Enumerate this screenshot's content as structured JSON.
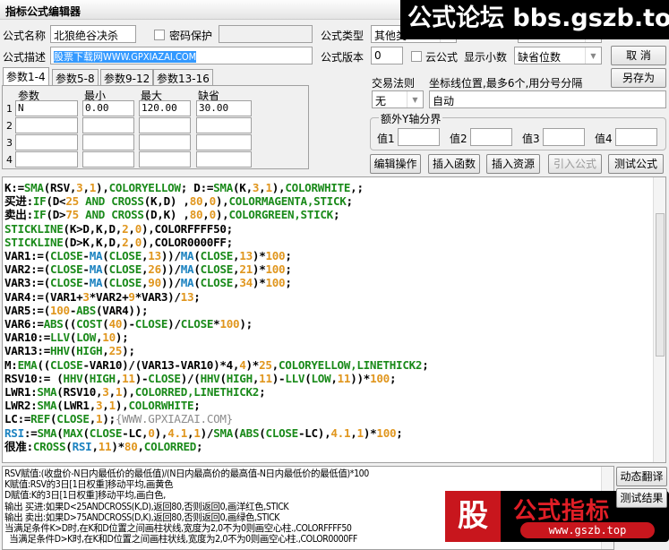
{
  "window": {
    "title": "指标公式编辑器"
  },
  "form": {
    "name_label": "公式名称",
    "name_value": "北狼绝谷决杀",
    "password_label": "密码保护",
    "password_value": "",
    "type_label": "公式类型",
    "type_value": "其他类",
    "desc_label": "公式描述",
    "desc_value": "股票下载网WWW.GPXIAZAI.COM",
    "version_label": "公式版本",
    "version_value": "0",
    "cloud_label": "云公式",
    "decimals_label": "显示小数",
    "decimals_value": "缺省位数",
    "trade_rule_label": "交易法则",
    "trade_rule_value": "无",
    "axis_label": "坐标线位置,最多6个,用分号分隔",
    "axis_value": "自动",
    "extra_y_label": "额外Y轴分界",
    "extra_values": [
      {
        "label": "值1",
        "value": ""
      },
      {
        "label": "值2",
        "value": ""
      },
      {
        "label": "值3",
        "value": ""
      },
      {
        "label": "值4",
        "value": ""
      }
    ]
  },
  "buttons": {
    "cancel": "取  消",
    "save_as": "另存为",
    "edit_ops": "编辑操作",
    "insert_func": "插入函数",
    "insert_res": "插入资源",
    "import_formula": "引入公式",
    "test_formula": "测试公式",
    "dynamic_translate": "动态翻译",
    "test_result": "测试结果"
  },
  "tabs": [
    "参数1-4",
    "参数5-8",
    "参数9-12",
    "参数13-16"
  ],
  "params": {
    "headers": [
      "参数",
      "最小",
      "最大",
      "缺省"
    ],
    "rows": [
      {
        "idx": "1",
        "name": "N",
        "min": "0.00",
        "max": "120.00",
        "def": "30.00"
      },
      {
        "idx": "2",
        "name": "",
        "min": "",
        "max": "",
        "def": ""
      },
      {
        "idx": "3",
        "name": "",
        "min": "",
        "max": "",
        "def": ""
      },
      {
        "idx": "4",
        "name": "",
        "min": "",
        "max": "",
        "def": ""
      }
    ]
  },
  "code": [
    [
      [
        "K:=",
        "t"
      ],
      [
        "SMA",
        "f"
      ],
      [
        "(RSV,",
        "t"
      ],
      [
        "3",
        "n"
      ],
      [
        ",",
        "t"
      ],
      [
        "1",
        "n"
      ],
      [
        "),",
        "t"
      ],
      [
        "COLORYELLOW",
        "f"
      ],
      [
        "; D:=",
        "t"
      ],
      [
        "SMA",
        "f"
      ],
      [
        "(K,",
        "t"
      ],
      [
        "3",
        "n"
      ],
      [
        ",",
        "t"
      ],
      [
        "1",
        "n"
      ],
      [
        "),",
        "t"
      ],
      [
        "COLORWHITE",
        "f"
      ],
      [
        ",;",
        "t"
      ]
    ],
    [
      [
        "买进:",
        "t"
      ],
      [
        "IF",
        "f"
      ],
      [
        "(D<",
        "t"
      ],
      [
        "25",
        "n"
      ],
      [
        " AND CROSS",
        "f"
      ],
      [
        "(K,D) ,",
        "t"
      ],
      [
        "80",
        "n"
      ],
      [
        ",",
        "t"
      ],
      [
        "0",
        "n"
      ],
      [
        "),",
        "t"
      ],
      [
        "COLORMAGENTA,STICK",
        "f"
      ],
      [
        ";",
        "t"
      ]
    ],
    [
      [
        "卖出:",
        "t"
      ],
      [
        "IF",
        "f"
      ],
      [
        "(D>",
        "t"
      ],
      [
        "75",
        "n"
      ],
      [
        " AND CROSS",
        "f"
      ],
      [
        "(D,K) ,",
        "t"
      ],
      [
        "80",
        "n"
      ],
      [
        ",",
        "t"
      ],
      [
        "0",
        "n"
      ],
      [
        "),",
        "t"
      ],
      [
        "COLORGREEN,STICK",
        "f"
      ],
      [
        ";",
        "t"
      ]
    ],
    [
      [
        "STICKLINE",
        "f"
      ],
      [
        "(K>D,K,D,",
        "t"
      ],
      [
        "2",
        "n"
      ],
      [
        ",",
        "t"
      ],
      [
        "0",
        "n"
      ],
      [
        "),COLORFFFF50;",
        "t"
      ]
    ],
    [
      [
        "STICKLINE",
        "f"
      ],
      [
        "(D>K,K,D,",
        "t"
      ],
      [
        "2",
        "n"
      ],
      [
        ",",
        "t"
      ],
      [
        "0",
        "n"
      ],
      [
        "),COLOR0000FF;",
        "t"
      ]
    ],
    [
      [
        "VAR1:=(",
        "t"
      ],
      [
        "CLOSE",
        "f"
      ],
      [
        "-",
        "t"
      ],
      [
        "MA",
        "b"
      ],
      [
        "(",
        "t"
      ],
      [
        "CLOSE",
        "f"
      ],
      [
        ",",
        "t"
      ],
      [
        "13",
        "n"
      ],
      [
        "))/",
        "t"
      ],
      [
        "MA",
        "b"
      ],
      [
        "(",
        "t"
      ],
      [
        "CLOSE",
        "f"
      ],
      [
        ",",
        "t"
      ],
      [
        "13",
        "n"
      ],
      [
        ")*",
        "t"
      ],
      [
        "100",
        "n"
      ],
      [
        ";",
        "t"
      ]
    ],
    [
      [
        "VAR2:=(",
        "t"
      ],
      [
        "CLOSE",
        "f"
      ],
      [
        "-",
        "t"
      ],
      [
        "MA",
        "b"
      ],
      [
        "(",
        "t"
      ],
      [
        "CLOSE",
        "f"
      ],
      [
        ",",
        "t"
      ],
      [
        "26",
        "n"
      ],
      [
        "))/",
        "t"
      ],
      [
        "MA",
        "b"
      ],
      [
        "(",
        "t"
      ],
      [
        "CLOSE",
        "f"
      ],
      [
        ",",
        "t"
      ],
      [
        "21",
        "n"
      ],
      [
        ")*",
        "t"
      ],
      [
        "100",
        "n"
      ],
      [
        ";",
        "t"
      ]
    ],
    [
      [
        "VAR3:=(",
        "t"
      ],
      [
        "CLOSE",
        "f"
      ],
      [
        "-",
        "t"
      ],
      [
        "MA",
        "b"
      ],
      [
        "(",
        "t"
      ],
      [
        "CLOSE",
        "f"
      ],
      [
        ",",
        "t"
      ],
      [
        "90",
        "n"
      ],
      [
        "))/",
        "t"
      ],
      [
        "MA",
        "b"
      ],
      [
        "(",
        "t"
      ],
      [
        "CLOSE",
        "f"
      ],
      [
        ",",
        "t"
      ],
      [
        "34",
        "n"
      ],
      [
        ")*",
        "t"
      ],
      [
        "100",
        "n"
      ],
      [
        ";",
        "t"
      ]
    ],
    [
      [
        "VAR4:=(VAR1+",
        "t"
      ],
      [
        "3",
        "n"
      ],
      [
        "*VAR2+",
        "t"
      ],
      [
        "9",
        "n"
      ],
      [
        "*VAR3)/",
        "t"
      ],
      [
        "13",
        "n"
      ],
      [
        ";",
        "t"
      ]
    ],
    [
      [
        "VAR5:=(",
        "t"
      ],
      [
        "100",
        "n"
      ],
      [
        "-",
        "t"
      ],
      [
        "ABS",
        "f"
      ],
      [
        "(VAR4));",
        "t"
      ]
    ],
    [
      [
        "VAR6:=",
        "t"
      ],
      [
        "ABS",
        "f"
      ],
      [
        "((",
        "t"
      ],
      [
        "COST",
        "f"
      ],
      [
        "(",
        "t"
      ],
      [
        "40",
        "n"
      ],
      [
        ")-",
        "t"
      ],
      [
        "CLOSE",
        "f"
      ],
      [
        ")/",
        "t"
      ],
      [
        "CLOSE",
        "f"
      ],
      [
        "*",
        "t"
      ],
      [
        "100",
        "n"
      ],
      [
        ");",
        "t"
      ]
    ],
    [
      [
        "VAR10:=",
        "t"
      ],
      [
        "LLV",
        "f"
      ],
      [
        "(",
        "t"
      ],
      [
        "LOW",
        "f"
      ],
      [
        ",",
        "t"
      ],
      [
        "10",
        "n"
      ],
      [
        ");",
        "t"
      ]
    ],
    [
      [
        "VAR13:=",
        "t"
      ],
      [
        "HHV",
        "f"
      ],
      [
        "(",
        "t"
      ],
      [
        "HIGH",
        "f"
      ],
      [
        ",",
        "t"
      ],
      [
        "25",
        "n"
      ],
      [
        ");",
        "t"
      ]
    ],
    [
      [
        "M:",
        "t"
      ],
      [
        "EMA",
        "f"
      ],
      [
        "((",
        "t"
      ],
      [
        "CLOSE",
        "f"
      ],
      [
        "-VAR10)/(VAR13-VAR10)*4,",
        "t"
      ],
      [
        "4",
        "n"
      ],
      [
        ")*",
        "t"
      ],
      [
        "25",
        "n"
      ],
      [
        ",",
        "t"
      ],
      [
        "COLORYELLOW,LINETHICK2",
        "f"
      ],
      [
        ";",
        "t"
      ]
    ],
    [
      [
        "RSV10:= (",
        "t"
      ],
      [
        "HHV",
        "f"
      ],
      [
        "(",
        "t"
      ],
      [
        "HIGH",
        "f"
      ],
      [
        ",",
        "t"
      ],
      [
        "11",
        "n"
      ],
      [
        ")-",
        "t"
      ],
      [
        "CLOSE",
        "f"
      ],
      [
        ")/(",
        "t"
      ],
      [
        "HHV",
        "f"
      ],
      [
        "(",
        "t"
      ],
      [
        "HIGH",
        "f"
      ],
      [
        ",",
        "t"
      ],
      [
        "11",
        "n"
      ],
      [
        ")-",
        "t"
      ],
      [
        "LLV",
        "f"
      ],
      [
        "(",
        "t"
      ],
      [
        "LOW",
        "f"
      ],
      [
        ",",
        "t"
      ],
      [
        "11",
        "n"
      ],
      [
        "))*",
        "t"
      ],
      [
        "100",
        "n"
      ],
      [
        ";",
        "t"
      ]
    ],
    [
      [
        "LWR1:",
        "t"
      ],
      [
        "SMA",
        "f"
      ],
      [
        "(RSV10,",
        "t"
      ],
      [
        "3",
        "n"
      ],
      [
        ",",
        "t"
      ],
      [
        "1",
        "n"
      ],
      [
        "),",
        "t"
      ],
      [
        "COLORRED,LINETHICK2",
        "f"
      ],
      [
        ";",
        "t"
      ]
    ],
    [
      [
        "LWR2:",
        "t"
      ],
      [
        "SMA",
        "f"
      ],
      [
        "(LWR1,",
        "t"
      ],
      [
        "3",
        "n"
      ],
      [
        ",",
        "t"
      ],
      [
        "1",
        "n"
      ],
      [
        "),",
        "t"
      ],
      [
        "COLORWHITE",
        "f"
      ],
      [
        ";",
        "t"
      ]
    ],
    [
      [
        "LC:=",
        "t"
      ],
      [
        "REF",
        "f"
      ],
      [
        "(",
        "t"
      ],
      [
        "CLOSE",
        "f"
      ],
      [
        ",",
        "t"
      ],
      [
        "1",
        "n"
      ],
      [
        ");",
        "t"
      ],
      [
        "{WWW.GPXIAZAI.COM}",
        "c"
      ]
    ],
    [
      [
        "RSI",
        "b"
      ],
      [
        ":=",
        "t"
      ],
      [
        "SMA",
        "f"
      ],
      [
        "(",
        "t"
      ],
      [
        "MAX",
        "f"
      ],
      [
        "(",
        "t"
      ],
      [
        "CLOSE",
        "f"
      ],
      [
        "-LC,",
        "t"
      ],
      [
        "0",
        "n"
      ],
      [
        "),",
        "t"
      ],
      [
        "4.1",
        "n"
      ],
      [
        ",",
        "t"
      ],
      [
        "1",
        "n"
      ],
      [
        ")/",
        "t"
      ],
      [
        "SMA",
        "f"
      ],
      [
        "(",
        "t"
      ],
      [
        "ABS",
        "f"
      ],
      [
        "(",
        "t"
      ],
      [
        "CLOSE",
        "f"
      ],
      [
        "-LC),",
        "t"
      ],
      [
        "4.1",
        "n"
      ],
      [
        ",",
        "t"
      ],
      [
        "1",
        "n"
      ],
      [
        ")*",
        "t"
      ],
      [
        "100",
        "n"
      ],
      [
        ";",
        "t"
      ]
    ],
    [
      [
        "很准:",
        "t"
      ],
      [
        "CROSS",
        "f"
      ],
      [
        "(",
        "t"
      ],
      [
        "RSI",
        "b"
      ],
      [
        ",",
        "t"
      ],
      [
        "11",
        "n"
      ],
      [
        ")*",
        "t"
      ],
      [
        "80",
        "n"
      ],
      [
        ",",
        "t"
      ],
      [
        "COLORRED",
        "f"
      ],
      [
        ";",
        "t"
      ]
    ]
  ],
  "output_lines": [
    "RSV赋值:(收盘价-N日内最低价的最低值)/(N日内最高价的最高值-N日内最低价的最低值)*100",
    "K赋值:RSV的3日[1日权重]移动平均,画黄色",
    "D赋值:K的3日[1日权重]移动平均,画白色,",
    "输出 买进:如果D<25ANDCROSS(K,D),返回80,否则返回0,画洋红色,STICK",
    "输出 卖出:如果D>75ANDCROSS(D,K),返回80,否则返回0,画绿色,STICK",
    "当满足条件K>D时,在K和D位置之间画柱状线,宽度为2,0不为0则画空心柱.,COLORFFFF50",
    "  当满足条件D>K时,在K和D位置之间画柱状线,宽度为2,0不为0则画空心柱.,COLOR0000FF"
  ],
  "watermarks": {
    "top": "公式论坛 bbs.gszb.top",
    "logo_char": "股",
    "logo_title": "公式指标",
    "logo_url": "www.gszb.top"
  },
  "colors": {
    "function": "#1a8a1a",
    "number": "#e0961e",
    "keyword_blue": "#1b82c0",
    "comment": "#8c8c8c",
    "selection": "#3399ff"
  }
}
